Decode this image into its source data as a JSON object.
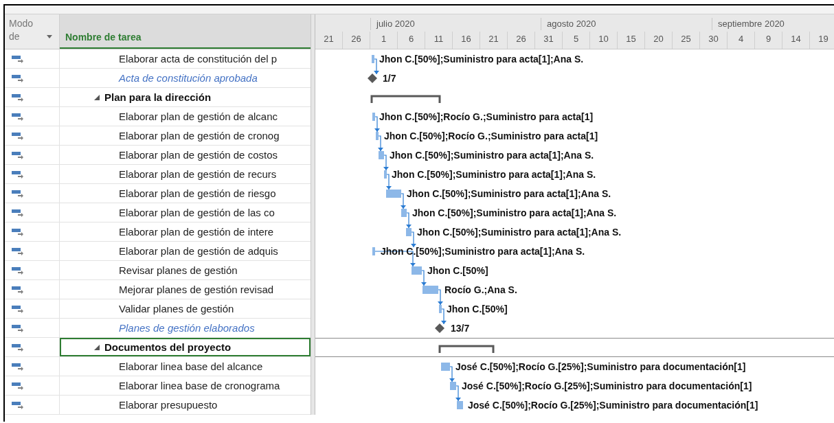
{
  "columns": {
    "mode": "Modo de",
    "name": "Nombre de tarea"
  },
  "timescale": {
    "months": [
      "julio 2020",
      "agosto 2020",
      "septiembre 2020"
    ],
    "days": [
      "21",
      "26",
      "1",
      "6",
      "11",
      "16",
      "21",
      "26",
      "31",
      "5",
      "10",
      "15",
      "20",
      "25",
      "30",
      "4",
      "9",
      "14",
      "19"
    ]
  },
  "tasks": [
    {
      "kind": "task",
      "name": "Elaborar acta de constitución del p",
      "label": "Jhon C.[50%];Suministro para acta[1];Ana S.",
      "selected": false
    },
    {
      "kind": "milestone",
      "name": "Acta de constitución aprobada",
      "label": "1/7",
      "selected": false
    },
    {
      "kind": "summary",
      "name": "Plan para la dirección",
      "expanded": true,
      "selected": false,
      "children": [
        {
          "kind": "task",
          "name": "Elaborar plan de gestión de alcanc",
          "label": "Jhon C.[50%];Rocío G.;Suministro para acta[1]",
          "selected": false
        },
        {
          "kind": "task",
          "name": "Elaborar plan de gestión de cronog",
          "label": "Jhon C.[50%];Rocío G.;Suministro para acta[1]",
          "selected": false
        },
        {
          "kind": "task",
          "name": "Elaborar plan de gestión de costos",
          "label": "Jhon C.[50%];Suministro para acta[1];Ana S.",
          "selected": false
        },
        {
          "kind": "task",
          "name": "Elaborar plan de gestión de recurs",
          "label": "Jhon C.[50%];Suministro para acta[1];Ana S.",
          "selected": false
        },
        {
          "kind": "task",
          "name": "Elaborar plan de gestión de riesgo",
          "label": "Jhon C.[50%];Suministro para acta[1];Ana S.",
          "selected": false
        },
        {
          "kind": "task",
          "name": "Elaborar plan de gestión de las co",
          "label": "Jhon C.[50%];Suministro para acta[1];Ana S.",
          "selected": false
        },
        {
          "kind": "task",
          "name": "Elaborar plan de gestión de intere",
          "label": "Jhon C.[50%];Suministro para acta[1];Ana S.",
          "selected": false
        },
        {
          "kind": "task",
          "name": "Elaborar plan de gestión de adquis",
          "label": "Jhon C.[50%];Suministro para acta[1];Ana S.",
          "selected": false
        },
        {
          "kind": "task",
          "name": "Revisar planes de gestión",
          "label": "Jhon C.[50%]",
          "selected": false
        },
        {
          "kind": "task",
          "name": "Mejorar planes de gestión revisad",
          "label": "Rocío G.;Ana S.",
          "selected": false
        },
        {
          "kind": "task",
          "name": "Validar planes de gestión",
          "label": "Jhon C.[50%]",
          "selected": false
        },
        {
          "kind": "milestone",
          "name": "Planes de gestión elaborados",
          "label": "13/7",
          "selected": false
        }
      ]
    },
    {
      "kind": "summary",
      "name": "Documentos del proyecto",
      "expanded": true,
      "selected": true,
      "children": [
        {
          "kind": "task",
          "name": "Elaborar linea base del alcance",
          "label": "José C.[50%];Rocío G.[25%];Suministro para documentación[1]",
          "selected": false
        },
        {
          "kind": "task",
          "name": "Elaborar linea base de cronograma",
          "label": "José C.[50%];Rocío G.[25%];Suministro para documentación[1]",
          "selected": false
        },
        {
          "kind": "task",
          "name": "Elaborar presupuesto",
          "label": "José C.[50%];Rocío G.[25%];Suministro para documentación[1]",
          "selected": false
        }
      ]
    }
  ]
}
